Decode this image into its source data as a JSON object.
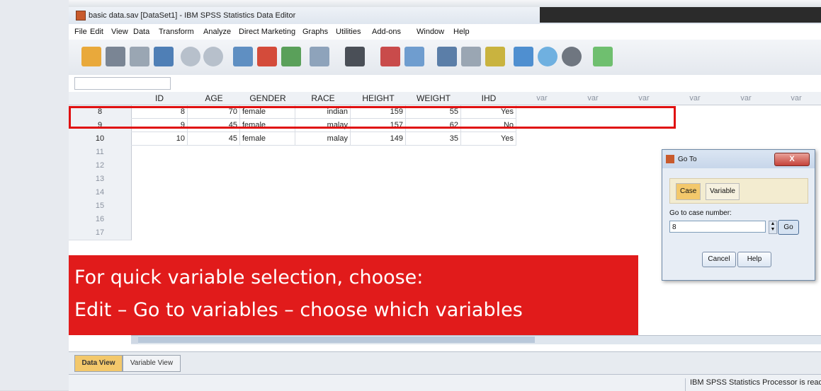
{
  "window": {
    "title": "basic data.sav [DataSet1] - IBM SPSS Statistics Data Editor"
  },
  "menu": [
    "File",
    "Edit",
    "View",
    "Data",
    "Transform",
    "Analyze",
    "Direct Marketing",
    "Graphs",
    "Utilities",
    "Add-ons",
    "Window",
    "Help"
  ],
  "toolbar": {
    "icons": [
      "open-folder-icon",
      "save-icon",
      "print-icon",
      "dialog-recall-icon",
      "undo-icon",
      "redo-icon",
      "goto-case-icon",
      "goto-variable-icon",
      "variables-icon",
      "run-descriptive-icon",
      "find-icon",
      "insert-cases-icon",
      "insert-variable-icon",
      "split-file-icon",
      "weight-cases-icon",
      "select-cases-icon",
      "value-labels-icon",
      "use-variable-sets-icon",
      "show-all-variables-icon",
      "spell-check-icon"
    ]
  },
  "grid": {
    "columns": [
      "ID",
      "AGE",
      "GENDER",
      "RACE",
      "HEIGHT",
      "WEIGHT",
      "IHD",
      "var",
      "var",
      "var",
      "var",
      "var",
      "var"
    ],
    "rows": [
      {
        "no": "8",
        "cells": [
          "8",
          "70",
          "female",
          "indian",
          "159",
          "55",
          "Yes"
        ]
      },
      {
        "no": "9",
        "cells": [
          "9",
          "45",
          "female",
          "malay",
          "157",
          "62",
          "No"
        ]
      },
      {
        "no": "10",
        "cells": [
          "10",
          "45",
          "female",
          "malay",
          "149",
          "35",
          "Yes"
        ]
      },
      {
        "no": "11",
        "cells": []
      },
      {
        "no": "12",
        "cells": []
      },
      {
        "no": "13",
        "cells": []
      },
      {
        "no": "14",
        "cells": []
      },
      {
        "no": "15",
        "cells": []
      },
      {
        "no": "16",
        "cells": []
      },
      {
        "no": "17",
        "cells": []
      }
    ]
  },
  "tabs": {
    "data_view": "Data View",
    "variable_view": "Variable View"
  },
  "status": {
    "text": "IBM SPSS Statistics Processor is ready"
  },
  "dialog": {
    "title": "Go To",
    "close": "X",
    "tab_case": "Case",
    "tab_variable": "Variable",
    "label": "Go to case number:",
    "value": "8",
    "go": "Go",
    "cancel": "Cancel",
    "help": "Help"
  },
  "banner": {
    "line1": "For quick variable selection, choose:",
    "line2": "Edit – Go to variables – choose which variables"
  },
  "colors": {
    "highlight": "#e01010",
    "banner": "#e11b1b",
    "active_tab": "#f3c86b"
  }
}
